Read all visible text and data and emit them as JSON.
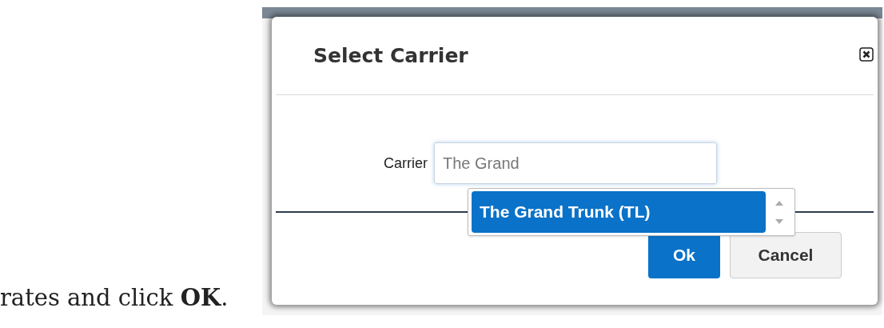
{
  "caption": "rates and click **OK**.",
  "dialog": {
    "title": "Select Carrier",
    "field": {
      "label": "Carrier",
      "value": "The Grand"
    },
    "suggestions": [
      {
        "label": "The Grand Trunk (TL)",
        "selected": true
      }
    ],
    "buttons": [
      {
        "label": "Ok",
        "kind": "primary"
      },
      {
        "label": "Cancel",
        "kind": "secondary"
      }
    ]
  }
}
